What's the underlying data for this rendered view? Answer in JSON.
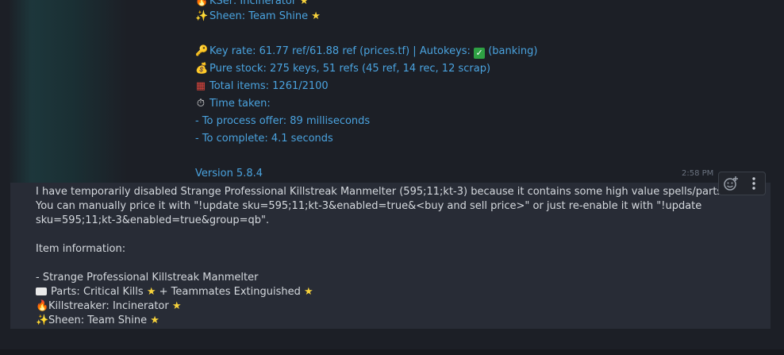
{
  "previous_message": {
    "killstreaker_partial": "KSer: Incinerator",
    "sheen": "Sheen: Team Shine",
    "key_rate": "Key rate: 61.77 ref/61.88 ref (prices.tf) | Autokeys: ",
    "autokeys_status": "(banking)",
    "pure_stock": "Pure stock: 275 keys, 51 refs (45 ref, 14 rec, 12 scrap)",
    "total_items": "Total items: 1261/2100",
    "time_taken": "Time taken:",
    "process_offer": "- To process offer: 89 milliseconds",
    "complete": "- To complete: 4.1 seconds",
    "version": "Version 5.8.4"
  },
  "timestamp": "2:58 PM",
  "current_message": {
    "line1": "I have temporarily disabled Strange Professional Killstreak Manmelter (595;11;kt-3) because it contains some high value spells/parts.",
    "line2": "You can manually price it with \"!update sku=595;11;kt-3&enabled=true&<buy and sell price>\" or just re-enable it with \"!update",
    "line3": "sku=595;11;kt-3&enabled=true&group=qb\".",
    "item_info_label": "Item information:",
    "item_name": "- Strange Professional Killstreak Manmelter",
    "parts_prefix": "Parts: Critical Kills",
    "parts_suffix": "+ Teammates Extinguished",
    "killstreaker": "Killstreaker: Incinerator",
    "sheen": "Sheen: Team Shine"
  },
  "icons": {
    "fire": "fire-icon",
    "sparkles": "sparkles-icon",
    "star": "star-icon",
    "key": "key-icon",
    "money_bag": "money-bag-icon",
    "box": "box-icon",
    "stopwatch": "stopwatch-icon",
    "check": "check-mark-icon",
    "keyboard": "keyboard-icon",
    "add_reaction": "add-reaction-icon",
    "more": "more-options-icon"
  },
  "colors": {
    "background": "#1c1f26",
    "highlight": "#282c36",
    "link_text": "#4aa3df",
    "message_text": "#d5d9de",
    "star": "#f7d23b"
  }
}
